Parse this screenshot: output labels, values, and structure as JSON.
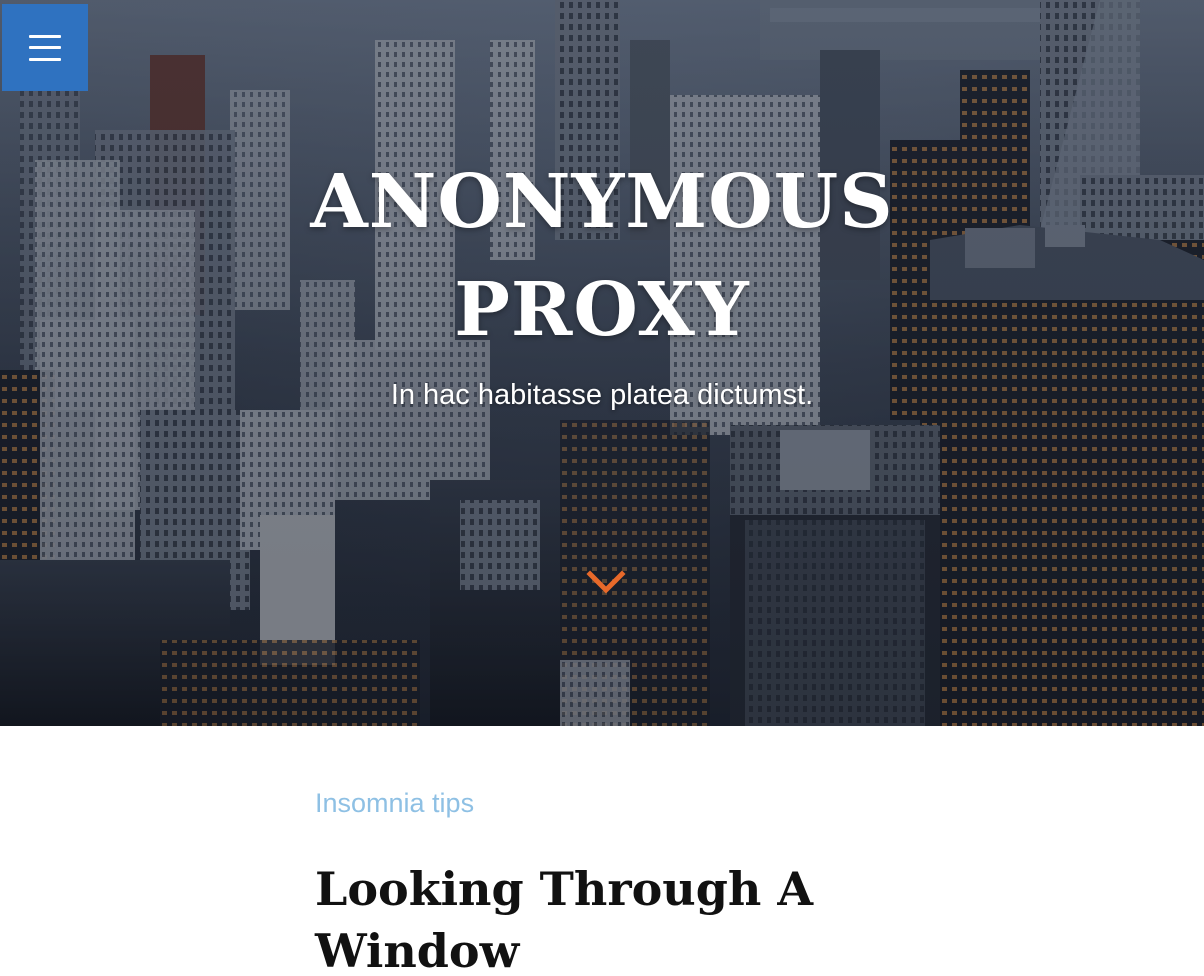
{
  "site": {
    "title_line1": "ANONYMOUS",
    "title_line2": "PROXY",
    "tagline": "In hac habitasse platea dictumst."
  },
  "menu": {
    "icon": "hamburger-icon",
    "color": "#2f72c0"
  },
  "scroll_indicator": {
    "icon": "chevron-down-icon",
    "color": "#e8692a"
  },
  "post": {
    "category": "Insomnia tips",
    "title": "Looking Through A Window"
  },
  "colors": {
    "category": "#8ec0e4",
    "title": "#111111"
  }
}
